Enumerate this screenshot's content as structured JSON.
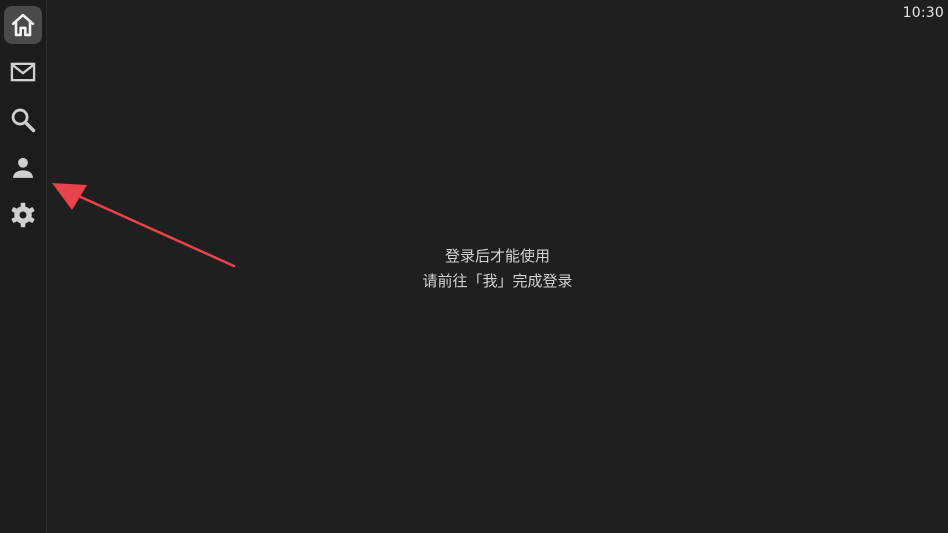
{
  "status_bar": {
    "time": "10:30"
  },
  "sidebar": {
    "items": [
      {
        "name": "home",
        "icon": "home-icon",
        "active": true
      },
      {
        "name": "mail",
        "icon": "mail-icon",
        "active": false
      },
      {
        "name": "search",
        "icon": "search-icon",
        "active": false
      },
      {
        "name": "profile",
        "icon": "person-icon",
        "active": false
      },
      {
        "name": "settings",
        "icon": "gear-icon",
        "active": false
      }
    ]
  },
  "main": {
    "line1": "登录后才能使用",
    "line2": "请前往「我」完成登录"
  },
  "colors": {
    "background": "#1f1f1f",
    "active_item": "#4a4a4a",
    "icon": "#cfcfcf",
    "arrow": "#e8434a"
  }
}
